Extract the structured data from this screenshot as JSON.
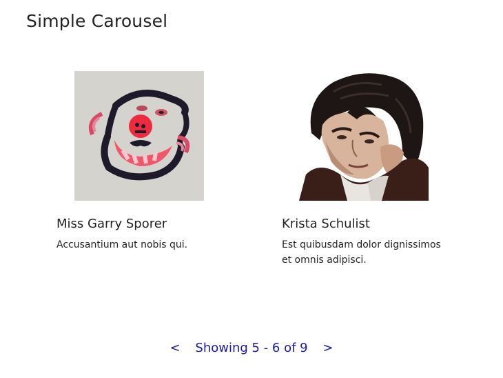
{
  "page": {
    "title": "Simple Carousel"
  },
  "cards": [
    {
      "name": "Miss Garry Sporer",
      "description": "Accusantium aut nobis qui."
    },
    {
      "name": "Krista Schulist",
      "description": "Est quibusdam dolor dignissimos et omnis adipisci."
    }
  ],
  "pager": {
    "prev": "<",
    "status": "Showing 5 - 6 of 9",
    "next": ">"
  },
  "colors": {
    "pager_link": "#1a1aa6"
  }
}
